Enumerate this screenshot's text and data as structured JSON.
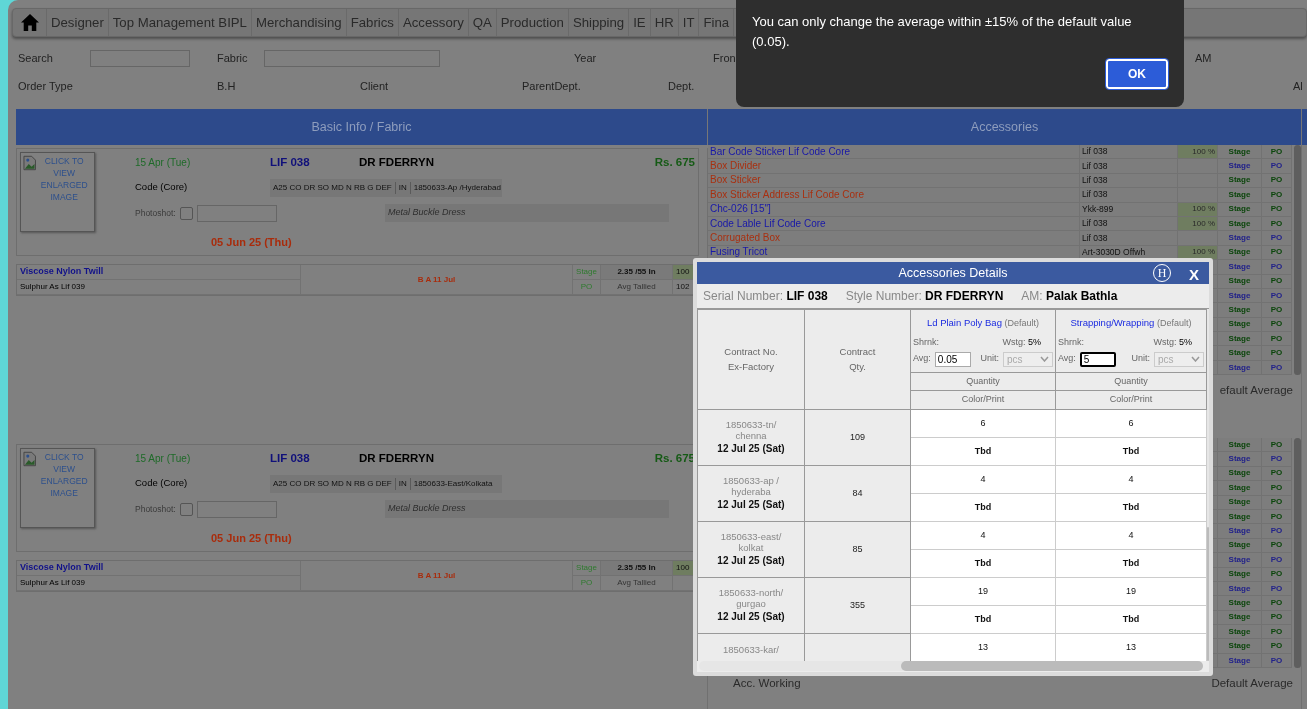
{
  "nav": {
    "items": [
      "Designer",
      "Top Management BIPL",
      "Merchandising",
      "Fabrics",
      "Accessory",
      "QA",
      "Production",
      "Shipping",
      "IE",
      "HR",
      "IT",
      "Fina"
    ]
  },
  "filters": {
    "rows": [
      [
        {
          "kind": "label",
          "text": "Search"
        },
        {
          "kind": "field"
        },
        {
          "kind": "label",
          "text": "Fabric"
        },
        {
          "kind": "field"
        },
        "",
        "",
        {
          "kind": "label",
          "text": "Year"
        },
        "",
        {
          "kind": "label",
          "text": "Fron"
        },
        {
          "kind": "label",
          "text": "AM"
        },
        ""
      ],
      [
        {
          "kind": "label",
          "text": "Order Type"
        },
        "",
        {
          "kind": "label",
          "text": "B.H"
        },
        "",
        {
          "kind": "label",
          "text": "Client"
        },
        {
          "kind": "label",
          "text": "ParentDept."
        },
        "",
        {
          "kind": "label",
          "text": "Dept."
        },
        "",
        "",
        {
          "kind": "label",
          "text": "Al"
        }
      ]
    ]
  },
  "table_headers": [
    "Basic Info / Fabric",
    "Accessories"
  ],
  "sections": [
    {
      "card": {
        "image_caption": "CLICK TO VIEW ENLARGED IMAGE",
        "date": "15 Apr (Tue)",
        "code": "Code (Core)",
        "serial": "LIF 038",
        "style": "DR FDERRYN",
        "price": "Rs. 675",
        "description": "A25 CO DR SO MD N RB G DEF",
        "country": "IN",
        "contract": "1850633-Ap /Hyderabad",
        "photoshot_label": "Photoshot:",
        "photoshot_checked": false,
        "note": "Metal Buckle Dress",
        "ship_date": "05 Jun 25 (Thu)"
      },
      "fabric": {
        "name": "Viscose Nylon Twill",
        "shade": "Sulphur As Lif 039",
        "status": "B A 11 Jul",
        "stage": "Stage",
        "po": "PO",
        "width": "2.35 /55 In",
        "tallied": "Avg Tallied",
        "percent": "100",
        "count": "102"
      },
      "accessories": [
        {
          "name": "Bar Code Sticker Lif Code Core",
          "code": "Lif 038",
          "percent": "100 %",
          "color": "#1818a8",
          "stage": {
            "label": "Stage",
            "color": "#0b460b"
          },
          "po": {
            "label": "PO",
            "color": "#0b460b"
          }
        },
        {
          "name": "Box Divider",
          "code": "Lif 038",
          "color": "#a83010",
          "stage": {
            "label": "Stage",
            "color": "#22228a"
          },
          "po": {
            "label": "PO",
            "color": "#22228a"
          }
        },
        {
          "name": "Box Sticker",
          "code": "Lif 038",
          "color": "#a83010",
          "stage": {
            "label": "Stage",
            "color": "#0b460b"
          },
          "po": {
            "label": "PO",
            "color": "#0b460b"
          }
        },
        {
          "name": "Box Sticker Address Lif Code Core",
          "code": "Lif 038",
          "color": "#a83010",
          "stage": {
            "label": "Stage",
            "color": "#0b460b"
          },
          "po": {
            "label": "PO",
            "color": "#0b460b"
          }
        },
        {
          "name": "Chc-026 [15\"]",
          "code": "Ykk-899",
          "percent": "100 %",
          "color": "#1818a8",
          "stage": {
            "label": "Stage",
            "color": "#0b460b"
          },
          "po": {
            "label": "PO",
            "color": "#0b460b"
          }
        },
        {
          "name": "Code Lable Lif Code Core",
          "code": "Lif 038",
          "percent": "100 %",
          "color": "#1818a8",
          "stage": {
            "label": "Stage",
            "color": "#0b460b"
          },
          "po": {
            "label": "PO",
            "color": "#0b460b"
          }
        },
        {
          "name": "Corrugated Box",
          "code": "Lif 038",
          "color": "#a83010",
          "stage": {
            "label": "Stage",
            "color": "#22228a"
          },
          "po": {
            "label": "PO",
            "color": "#22228a"
          }
        },
        {
          "name": "Fusing Tricot",
          "code": "Art-3030D Offwh",
          "percent": "100 %",
          "color": "#1818a8",
          "stage": {
            "label": "Stage",
            "color": "#0b460b"
          },
          "po": {
            "label": "PO",
            "color": "#0b460b"
          }
        },
        {
          "stage": {
            "label": "Stage",
            "color": "#22228a"
          },
          "po": {
            "label": "PO",
            "color": "#22228a"
          }
        },
        {
          "stage": {
            "label": "Stage",
            "color": "#0b460b"
          },
          "po": {
            "label": "PO",
            "color": "#0b460b"
          }
        },
        {
          "stage": {
            "label": "Stage",
            "color": "#22228a"
          },
          "po": {
            "label": "PO",
            "color": "#22228a"
          }
        },
        {
          "stage": {
            "label": "Stage",
            "color": "#0b460b"
          },
          "po": {
            "label": "PO",
            "color": "#0b460b"
          }
        },
        {
          "stage": {
            "label": "Stage",
            "color": "#0b460b"
          },
          "po": {
            "label": "PO",
            "color": "#0b460b"
          }
        },
        {
          "stage": {
            "label": "Stage",
            "color": "#0b460b"
          },
          "po": {
            "label": "PO",
            "color": "#0b460b"
          }
        },
        {
          "stage": {
            "label": "Stage",
            "color": "#0b460b"
          },
          "po": {
            "label": "PO",
            "color": "#0b460b"
          }
        },
        {
          "stage": {
            "label": "Stage",
            "color": "#22228a"
          },
          "po": {
            "label": "PO",
            "color": "#22228a"
          }
        }
      ],
      "footer": {
        "right": "efault Average"
      }
    },
    {
      "card": {
        "image_caption": "CLICK TO VIEW ENLARGED IMAGE",
        "date": "15 Apr (Tue)",
        "code": "Code (Core)",
        "serial": "LIF 038",
        "style": "DR FDERRYN",
        "price": "Rs. 675",
        "description": "A25 CO DR SO MD N RB G DEF",
        "country": "IN",
        "contract": "1850633-East/Kolkata",
        "photoshot_label": "Photoshot:",
        "photoshot_checked": false,
        "note": "Metal Buckle Dress",
        "ship_date": "05 Jun 25 (Thu)"
      },
      "fabric": {
        "name": "Viscose Nylon Twill",
        "shade": "Sulphur As Lif 039",
        "status": "B A 11 Jul",
        "stage": "Stage",
        "po": "PO",
        "width": "2.35 /55 In",
        "tallied": "Avg Tallied",
        "percent": "100"
      },
      "accessories": [
        {
          "stage": {
            "label": "Stage",
            "color": "#0b460b"
          },
          "po": {
            "label": "PO",
            "color": "#0b460b"
          }
        },
        {
          "stage": {
            "label": "Stage",
            "color": "#22228a"
          },
          "po": {
            "label": "PO",
            "color": "#22228a"
          }
        },
        {
          "stage": {
            "label": "Stage",
            "color": "#0b460b"
          },
          "po": {
            "label": "PO",
            "color": "#0b460b"
          }
        },
        {
          "stage": {
            "label": "Stage",
            "color": "#0b460b"
          },
          "po": {
            "label": "PO",
            "color": "#0b460b"
          }
        },
        {
          "stage": {
            "label": "Stage",
            "color": "#0b460b"
          },
          "po": {
            "label": "PO",
            "color": "#0b460b"
          }
        },
        {
          "stage": {
            "label": "Stage",
            "color": "#0b460b"
          },
          "po": {
            "label": "PO",
            "color": "#0b460b"
          }
        },
        {
          "stage": {
            "label": "Stage",
            "color": "#22228a"
          },
          "po": {
            "label": "PO",
            "color": "#22228a"
          }
        },
        {
          "stage": {
            "label": "Stage",
            "color": "#0b460b"
          },
          "po": {
            "label": "PO",
            "color": "#0b460b"
          }
        },
        {
          "stage": {
            "label": "Stage",
            "color": "#22228a"
          },
          "po": {
            "label": "PO",
            "color": "#22228a"
          }
        },
        {
          "stage": {
            "label": "Stage",
            "color": "#0b460b"
          },
          "po": {
            "label": "PO",
            "color": "#0b460b"
          }
        },
        {
          "stage": {
            "label": "Stage",
            "color": "#22228a"
          },
          "po": {
            "label": "PO",
            "color": "#22228a"
          }
        },
        {
          "stage": {
            "label": "Stage",
            "color": "#0b460b"
          },
          "po": {
            "label": "PO",
            "color": "#0b460b"
          }
        },
        {
          "stage": {
            "label": "Stage",
            "color": "#0b460b"
          },
          "po": {
            "label": "PO",
            "color": "#0b460b"
          }
        },
        {
          "stage": {
            "label": "Stage",
            "color": "#0b460b"
          },
          "po": {
            "label": "PO",
            "color": "#0b460b"
          }
        },
        {
          "stage": {
            "label": "Stage",
            "color": "#0b460b"
          },
          "po": {
            "label": "PO",
            "color": "#0b460b"
          }
        },
        {
          "stage": {
            "label": "Stage",
            "color": "#22228a"
          },
          "po": {
            "label": "PO",
            "color": "#22228a"
          }
        }
      ],
      "footer": {
        "left": "Acc. Working",
        "right": "Default Average"
      }
    }
  ],
  "modal": {
    "title": "Accessories Details",
    "help": "H",
    "close": "X",
    "info": [
      {
        "label": "Serial Number:",
        "value": "LIF 038"
      },
      {
        "label": "Style Number:",
        "value": "DR FDERRYN"
      },
      {
        "label": "AM:",
        "value": "Palak Bathla"
      }
    ],
    "columns": [
      "Contract No. Ex-Factory",
      "Contract Qty."
    ],
    "accessories": [
      {
        "name": "Ld Plain Poly Bag",
        "tag": "(Default)",
        "shrink_label": "Shrnk:",
        "wastage_label": "Wstg:",
        "wastage": "5%",
        "avg_label": "Avg:",
        "avg": "0.05",
        "avg_focused": false,
        "unit_label": "Unit:",
        "unit": "pcs",
        "quantity_header": "Quantity",
        "print_header": "Color/Print"
      },
      {
        "name": "Strapping/Wrapping",
        "tag": "(Default)",
        "shrink_label": "Shrnk:",
        "wastage_label": "Wstg:",
        "wastage": "5%",
        "avg_label": "Avg:",
        "avg": "5",
        "avg_focused": true,
        "unit_label": "Unit:",
        "unit": "pcs",
        "quantity_header": "Quantity",
        "print_header": "Color/Print"
      }
    ],
    "rows": [
      {
        "contract": "1850633-tn/ chenna",
        "date": "12 Jul 25 (Sat)",
        "qty": "109",
        "values": [
          {
            "quantity": "6",
            "print": "Tbd"
          },
          {
            "quantity": "6",
            "print": "Tbd"
          }
        ]
      },
      {
        "contract": "1850633-ap / hyderaba",
        "date": "12 Jul 25 (Sat)",
        "qty": "84",
        "values": [
          {
            "quantity": "4",
            "print": "Tbd"
          },
          {
            "quantity": "4",
            "print": "Tbd"
          }
        ]
      },
      {
        "contract": "1850633-east/ kolkat",
        "date": "12 Jul 25 (Sat)",
        "qty": "85",
        "values": [
          {
            "quantity": "4",
            "print": "Tbd"
          },
          {
            "quantity": "4",
            "print": "Tbd"
          }
        ]
      },
      {
        "contract": "1850633-north/ gurgao",
        "date": "12 Jul 25 (Sat)",
        "qty": "355",
        "values": [
          {
            "quantity": "19",
            "print": "Tbd"
          },
          {
            "quantity": "19",
            "print": "Tbd"
          }
        ]
      },
      {
        "contract": "1850633-kar/",
        "values": [
          {
            "quantity": "13"
          },
          {
            "quantity": "13"
          }
        ]
      }
    ]
  },
  "alert": {
    "message": "You can only change the average within ±15% of the default value (0.05).",
    "button": "OK"
  }
}
